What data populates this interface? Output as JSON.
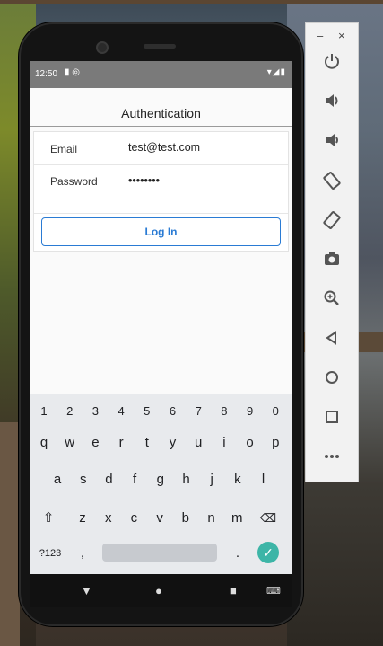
{
  "status_bar": {
    "time": "12:50",
    "left_icons": "▮ ◎",
    "right_icons": "▾◢▮"
  },
  "nav": {
    "title": "Authentication"
  },
  "form": {
    "email_label": "Email",
    "email_value": "test@test.com",
    "password_label": "Password",
    "password_value": "••••••••",
    "login_label": "Log In"
  },
  "keyboard": {
    "numbers": [
      "1",
      "2",
      "3",
      "4",
      "5",
      "6",
      "7",
      "8",
      "9",
      "0"
    ],
    "row1": [
      "q",
      "w",
      "e",
      "r",
      "t",
      "y",
      "u",
      "i",
      "o",
      "p"
    ],
    "row2": [
      "a",
      "s",
      "d",
      "f",
      "g",
      "h",
      "j",
      "k",
      "l"
    ],
    "row3": [
      "z",
      "x",
      "c",
      "v",
      "b",
      "n",
      "m"
    ],
    "shift": "⇧",
    "backspace": "⌫",
    "symbols": "?123",
    "comma": ",",
    "period": ".",
    "enter": "✓"
  },
  "system_nav": {
    "back": "▼",
    "home": "●",
    "recents": "■",
    "keyboard": "⌨"
  },
  "emulator_panel": {
    "minimize": "–",
    "close": "×",
    "icons": [
      "power-icon",
      "volume-up-icon",
      "volume-down-icon",
      "rotate-left-icon",
      "rotate-right-icon",
      "camera-icon",
      "zoom-icon",
      "back-icon",
      "home-icon",
      "overview-icon",
      "more-icon"
    ]
  },
  "colors": {
    "accent": "#2a7bd4",
    "enter": "#3db5a7",
    "statusbar": "#7a7a7a"
  }
}
